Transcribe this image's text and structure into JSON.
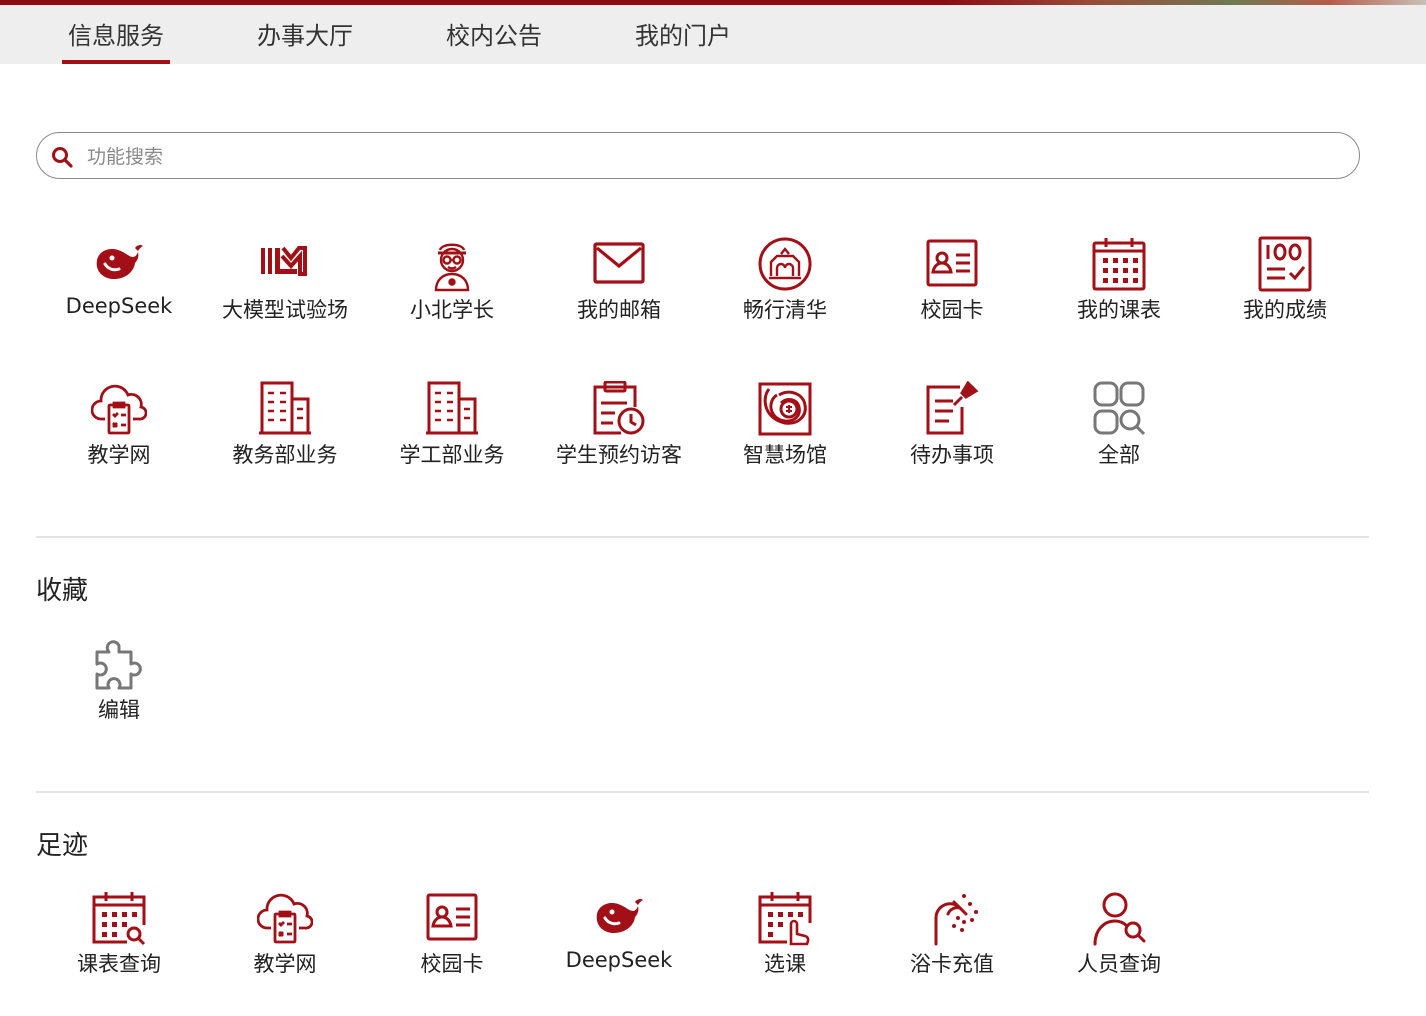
{
  "colors": {
    "accent": "#a30f16",
    "tab_bg": "#eeeeee",
    "muted_icon": "#777777"
  },
  "tabs": [
    {
      "label": "信息服务",
      "active": true
    },
    {
      "label": "办事大厅",
      "active": false
    },
    {
      "label": "校内公告",
      "active": false
    },
    {
      "label": "我的门户",
      "active": false
    }
  ],
  "search": {
    "placeholder": "功能搜索",
    "icon": "search-icon"
  },
  "apps": [
    {
      "label": "DeepSeek",
      "icon": "deepseek-whale-icon"
    },
    {
      "label": "大模型试验场",
      "icon": "llm-logo-icon"
    },
    {
      "label": "小北学长",
      "icon": "student-avatar-icon"
    },
    {
      "label": "我的邮箱",
      "icon": "mail-icon"
    },
    {
      "label": "畅行清华",
      "icon": "gate-circle-icon"
    },
    {
      "label": "校园卡",
      "icon": "id-card-icon"
    },
    {
      "label": "我的课表",
      "icon": "calendar-icon"
    },
    {
      "label": "我的成绩",
      "icon": "score-sheet-icon"
    },
    {
      "label": "教学网",
      "icon": "cloud-checklist-icon"
    },
    {
      "label": "教务部业务",
      "icon": "building-icon"
    },
    {
      "label": "学工部业务",
      "icon": "building-icon"
    },
    {
      "label": "学生预约访客",
      "icon": "clipboard-clock-icon"
    },
    {
      "label": "智慧场馆",
      "icon": "venue-logo-icon"
    },
    {
      "label": "待办事项",
      "icon": "todo-pin-icon"
    },
    {
      "label": "全部",
      "icon": "grid-search-icon"
    }
  ],
  "favorites": {
    "title": "收藏",
    "items": [
      {
        "label": "编辑",
        "icon": "puzzle-icon"
      }
    ]
  },
  "history": {
    "title": "足迹",
    "items": [
      {
        "label": "课表查询",
        "icon": "calendar-search-icon"
      },
      {
        "label": "教学网",
        "icon": "cloud-checklist-icon"
      },
      {
        "label": "校园卡",
        "icon": "id-card-icon"
      },
      {
        "label": "DeepSeek",
        "icon": "deepseek-whale-icon"
      },
      {
        "label": "选课",
        "icon": "calendar-click-icon"
      },
      {
        "label": "浴卡充值",
        "icon": "shower-icon"
      },
      {
        "label": "人员查询",
        "icon": "person-search-icon"
      }
    ]
  }
}
